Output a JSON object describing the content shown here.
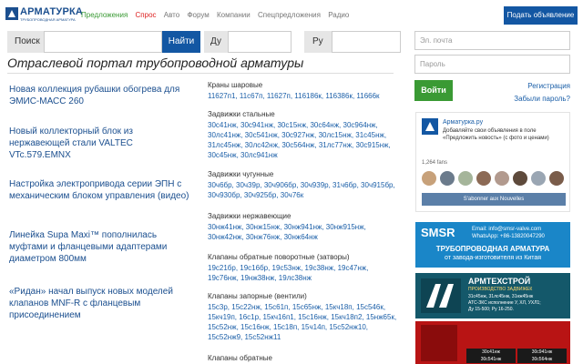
{
  "header": {
    "logo_text": "АРМАТУРКА",
    "logo_sub": "ТРУБОПРОВОДНАЯ АРМАТУРА",
    "nav": [
      "Предложения",
      "Спрос",
      "Авто",
      "Форум",
      "Компании",
      "Спецпредложения",
      "Радио"
    ],
    "post_button": "Подать объявление"
  },
  "search": {
    "search_label": "Поиск",
    "find_button": "Найти",
    "du_label": "Ду",
    "ru_label": "Ру"
  },
  "page_title": "Отраслевой портал трубопроводной арматуры",
  "news": [
    "Новая коллекция рубашки обогрева для ЭМИС-МАСС 260",
    "Новый коллекторный блок из нержавеющей стали VALTEC VTc.579.EMNX",
    "Настройка электропривода серии ЭПН с механическим блоком управления (видео)",
    "Линейка Supa Maxi™ пополнилась муфтами и фланцевыми адаптерами диаметром 800мм",
    "«Ридан» начал выпуск новых моделей клапанов MNF-R с фланцевым присоединением"
  ],
  "catalog": [
    {
      "title": "Краны шаровые",
      "links": "11627п1, 11с67п, 11627п, 116186к, 116386к, 11666к"
    },
    {
      "title": "Задвижки стальные",
      "links": "30с41нж, 30с941нж, 30с15нж, 30с64нж, 30с964нж, 30лс41нж, 30с541нж, 30с927нж, 30лс15нж, 31с45нж, 31лс45нж, 30лс42нж, 30с564нж, 31лс77нж, 30с915нж, 30с45нж, 30лс941нж"
    },
    {
      "title": "Задвижки чугунные",
      "links": "30ч6бр, 30ч39р, 30ч906бр, 30ч939р, 31ч6бр, 30ч915бр, 30ч930бр, 30ч925бр, 30ч76к"
    },
    {
      "title": "Задвижки нержавеющие",
      "links": "30нж41нж, 30нж15нж, 30нж941нж, 30нж915нж, 30нж42нж, 30нж76нж, 30нж64нж"
    },
    {
      "title": "Клапаны обратные поворотные (затворы)",
      "links": "19с21бр, 19с16бр, 19с53нж, 19с38нж, 19с47нж, 19с76нж, 19нж38нж, 19лс38нж"
    },
    {
      "title": "Клапаны запорные (вентили)",
      "links": "15с3р, 15с22нж, 15с61п, 15с65нж, 15кч18п, 15с546к, 15кч19п, 16с1р, 15кч16п1, 15с16нж, 15кч18п2, 15нж65к, 15с52нж, 15с16нж, 15с18п, 15ч14п, 15с52нж10, 15с52нж9, 15с52нж11"
    },
    {
      "title": "Клапаны обратные",
      "links": ""
    }
  ],
  "login": {
    "email_placeholder": "Эл. почта",
    "password_placeholder": "Пароль",
    "login_button": "Войти",
    "register_link": "Регистрация",
    "forgot_link": "Забыли пароль?"
  },
  "vk_widget": {
    "name": "Арматурка.ру",
    "post_text": "Добавляйте свои объявления в поле «Предложить новость» (с фото и ценами)",
    "fans": "1,264 fans",
    "subscribe": "S'abonner aux Nouvelles"
  },
  "banners": {
    "smsr_brand": "SMSR",
    "smsr_email": "Email: info@smsr-valve.com",
    "smsr_phone": "WhatsApp: +86-13820047290",
    "smsr_line1": "ТРУБОПРОВОДНАЯ АРМАТУРА",
    "smsr_line2": "от завода-изготовителя из Китая",
    "atp_brand": "АРМТЕХСТРОЙ",
    "atp_sub": "ПРОИЗВОДСТВО ЗАДВИЖЕК",
    "atp_items": "31с45нж, 31лс45нж, 31нж45нж",
    "atp_items2": "АТС-ЗКС исполнение У, ХЛ, УХЛ1;",
    "atp_items3": "Ду 15-500; Ру 16-250.",
    "red_items": [
      "30с41нж",
      "30с541нж",
      "30с941нж",
      "30с564нж"
    ]
  },
  "colors": {
    "accent": "#1357a3",
    "green": "#3a9a34",
    "red": "#d22222",
    "link": "#1b5fa8"
  }
}
